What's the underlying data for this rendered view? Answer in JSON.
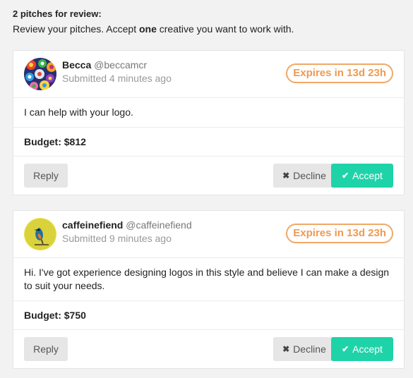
{
  "header": {
    "title": "2 pitches for review:",
    "subtitle_pre": "Review your pitches. Accept ",
    "subtitle_bold": "one",
    "subtitle_post": " creative you want to work with."
  },
  "pitches": [
    {
      "name": "Becca",
      "handle": "@beccamcr",
      "submitted": "Submitted 4 minutes ago",
      "expires": "Expires in 13d 23h",
      "message": "I can help with your logo.",
      "budget": "Budget: $812",
      "reply_label": "Reply",
      "decline_label": "Decline",
      "accept_label": "Accept",
      "avatar_icon": "colorful-flower-avatar"
    },
    {
      "name": "caffeinefiend",
      "handle": "@caffeinefiend",
      "submitted": "Submitted 9 minutes ago",
      "expires": "Expires in 13d 23h",
      "message": "Hi. I've got experience designing logos in this style and believe I can make a design to suit your needs.",
      "budget": "Budget: $750",
      "reply_label": "Reply",
      "decline_label": "Decline",
      "accept_label": "Accept",
      "avatar_icon": "kingfisher-bird-avatar"
    }
  ],
  "colors": {
    "accent": "#1fd3a9",
    "expires": "#ef9a4f",
    "background": "#f2f2f2"
  }
}
